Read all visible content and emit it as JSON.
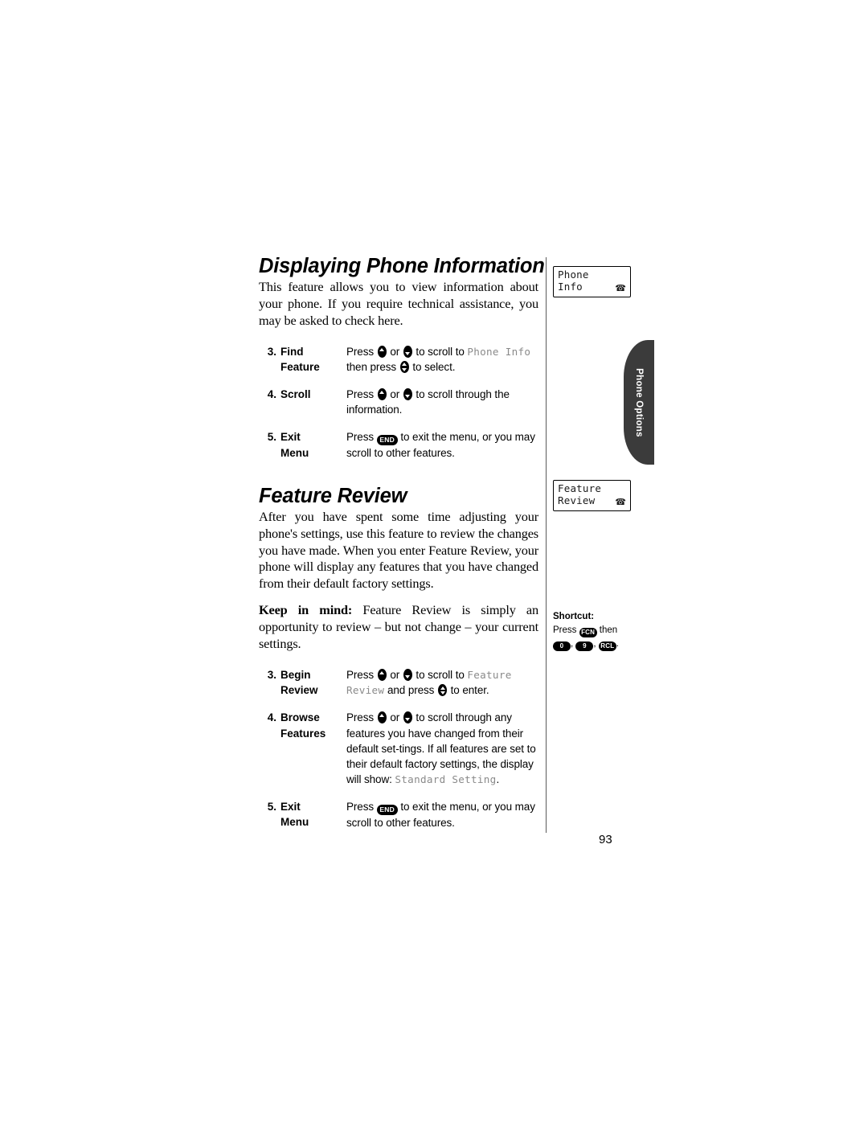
{
  "page": {
    "number": "93"
  },
  "sections": [
    {
      "title": "Displaying Phone Information",
      "intro": "This feature allows you to view information about your phone. If you require technical assistance, you may be asked to check here.",
      "display": {
        "line1": "Phone",
        "line2": "Info",
        "icon": "telephone-icon",
        "icon_glyph": "☎"
      },
      "steps": [
        {
          "num": "3.",
          "label": "Find\nFeature",
          "desc_parts": [
            {
              "type": "text",
              "value": "Press "
            },
            {
              "type": "navkey",
              "value": "up"
            },
            {
              "type": "text",
              "value": " or "
            },
            {
              "type": "navkey",
              "value": "down"
            },
            {
              "type": "text",
              "value": " to scroll to "
            },
            {
              "type": "lcd",
              "value": "Phone Info"
            },
            {
              "type": "text",
              "value": " then press "
            },
            {
              "type": "navkey",
              "value": "both"
            },
            {
              "type": "text",
              "value": " to select."
            }
          ]
        },
        {
          "num": "4.",
          "label": "Scroll",
          "desc_parts": [
            {
              "type": "text",
              "value": "Press "
            },
            {
              "type": "navkey",
              "value": "up"
            },
            {
              "type": "text",
              "value": " or "
            },
            {
              "type": "navkey",
              "value": "down"
            },
            {
              "type": "text",
              "value": " to scroll through the information."
            }
          ]
        },
        {
          "num": "5.",
          "label": "Exit\nMenu",
          "desc_parts": [
            {
              "type": "text",
              "value": "Press "
            },
            {
              "type": "key",
              "value": "END",
              "style": "end"
            },
            {
              "type": "text",
              "value": " to exit the menu, or you may scroll to other features."
            }
          ]
        }
      ]
    },
    {
      "title": "Feature Review",
      "intro": "After you have spent some time adjusting your phone's settings, use this feature to review the changes you have made. When you enter Feature Review, your phone will display any features that you have changed from their default factory settings.",
      "keep_in_mind_label": "Keep in mind:",
      "keep_in_mind_text": " Feature Review is simply an opportunity to review – but not change – your current settings.",
      "display": {
        "line1": "Feature",
        "line2": "Review",
        "icon": "telephone-icon",
        "icon_glyph": "☎"
      },
      "steps": [
        {
          "num": "3.",
          "label": "Begin\nReview",
          "desc_parts": [
            {
              "type": "text",
              "value": "Press "
            },
            {
              "type": "navkey",
              "value": "up"
            },
            {
              "type": "text",
              "value": " or "
            },
            {
              "type": "navkey",
              "value": "down"
            },
            {
              "type": "text",
              "value": " to scroll to "
            },
            {
              "type": "lcd",
              "value": "Feature Review"
            },
            {
              "type": "text",
              "value": " and press "
            },
            {
              "type": "navkey",
              "value": "both"
            },
            {
              "type": "text",
              "value": " to enter."
            }
          ]
        },
        {
          "num": "4.",
          "label": "Browse\nFeatures",
          "desc_parts": [
            {
              "type": "text",
              "value": "Press "
            },
            {
              "type": "navkey",
              "value": "up"
            },
            {
              "type": "text",
              "value": " or "
            },
            {
              "type": "navkey",
              "value": "down"
            },
            {
              "type": "text",
              "value": " to scroll through any features you have changed from their default set-tings. If all features are set to their default factory settings, the display will show: "
            },
            {
              "type": "lcd",
              "value": "Standard Setting"
            },
            {
              "type": "text",
              "value": "."
            }
          ]
        },
        {
          "num": "5.",
          "label": "Exit\nMenu",
          "desc_parts": [
            {
              "type": "text",
              "value": "Press "
            },
            {
              "type": "key",
              "value": "END",
              "style": "end"
            },
            {
              "type": "text",
              "value": " to exit the menu, or you may scroll to other features."
            }
          ]
        }
      ]
    }
  ],
  "side_tab": {
    "label": "Phone Options",
    "background": "#3b3b3b",
    "text_color": "#ffffff"
  },
  "shortcut": {
    "title": "Shortcut:",
    "press_label": "Press ",
    "fcn_key": "FCN",
    "then_label": " then",
    "keys": [
      "0",
      "9",
      "RCL"
    ],
    "separator": ", ",
    "terminator": "."
  }
}
